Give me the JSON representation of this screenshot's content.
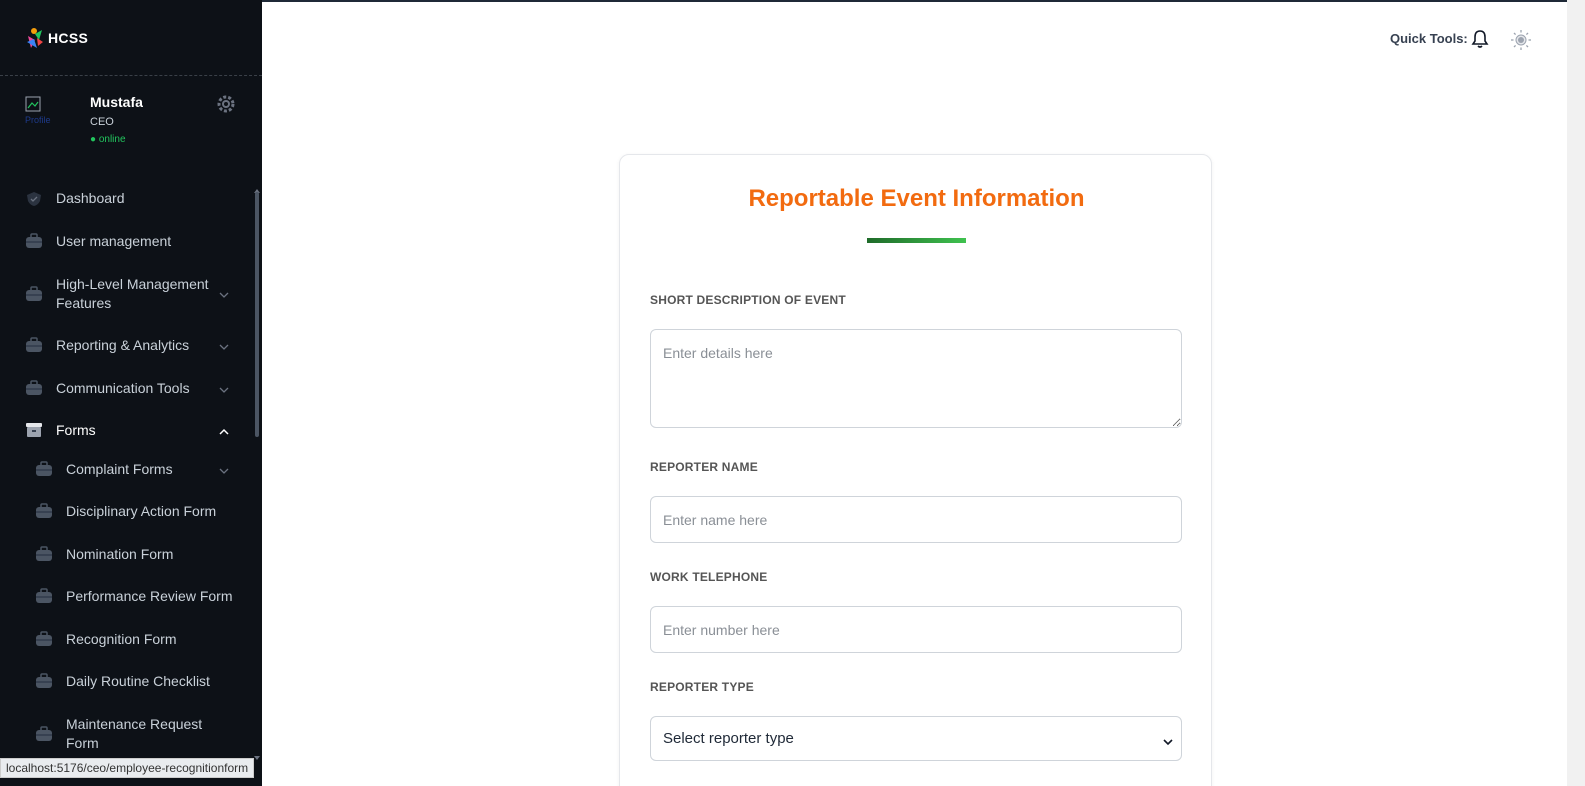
{
  "brand": {
    "name": "HCSS"
  },
  "profile": {
    "name": "Mustafa",
    "role": "CEO",
    "status": "● online",
    "avatar_alt": "Profile"
  },
  "header": {
    "quick_tools_label": "Quick Tools:"
  },
  "sidebar": {
    "items": [
      {
        "label": "Dashboard",
        "icon": "shield-icon"
      },
      {
        "label": "User management",
        "icon": "briefcase-icon"
      },
      {
        "label": "High-Level Management Features",
        "icon": "briefcase-icon",
        "expandable": true
      },
      {
        "label": "Reporting & Analytics",
        "icon": "briefcase-icon",
        "expandable": true
      },
      {
        "label": "Communication Tools",
        "icon": "briefcase-icon",
        "expandable": true
      },
      {
        "label": "Forms",
        "icon": "archive-icon",
        "expandable": true,
        "expanded": true
      },
      {
        "label": "Complaint Forms",
        "icon": "briefcase-icon",
        "expandable": true
      },
      {
        "label": "Disciplinary Action Form",
        "icon": "briefcase-icon"
      },
      {
        "label": "Nomination Form",
        "icon": "briefcase-icon"
      },
      {
        "label": "Performance Review Form",
        "icon": "briefcase-icon"
      },
      {
        "label": "Recognition Form",
        "icon": "briefcase-icon"
      },
      {
        "label": "Daily Routine Checklist",
        "icon": "briefcase-icon"
      },
      {
        "label": "Maintenance Request Form",
        "icon": "briefcase-icon"
      }
    ]
  },
  "status_bar": {
    "url": "localhost:5176/ceo/employee-recognitionform"
  },
  "form": {
    "title": "Reportable Event Information",
    "short_description": {
      "label": "SHORT DESCRIPTION OF EVENT",
      "placeholder": "Enter details here"
    },
    "reporter_name": {
      "label": "REPORTER NAME",
      "placeholder": "Enter name here"
    },
    "work_telephone": {
      "label": "WORK TELEPHONE",
      "placeholder": "Enter number here"
    },
    "reporter_type": {
      "label": "REPORTER TYPE",
      "selected": "Select reporter type"
    }
  },
  "colors": {
    "accent_orange": "#f26b10",
    "sidebar_bg": "#0d1117",
    "online_green": "#22c55e"
  }
}
